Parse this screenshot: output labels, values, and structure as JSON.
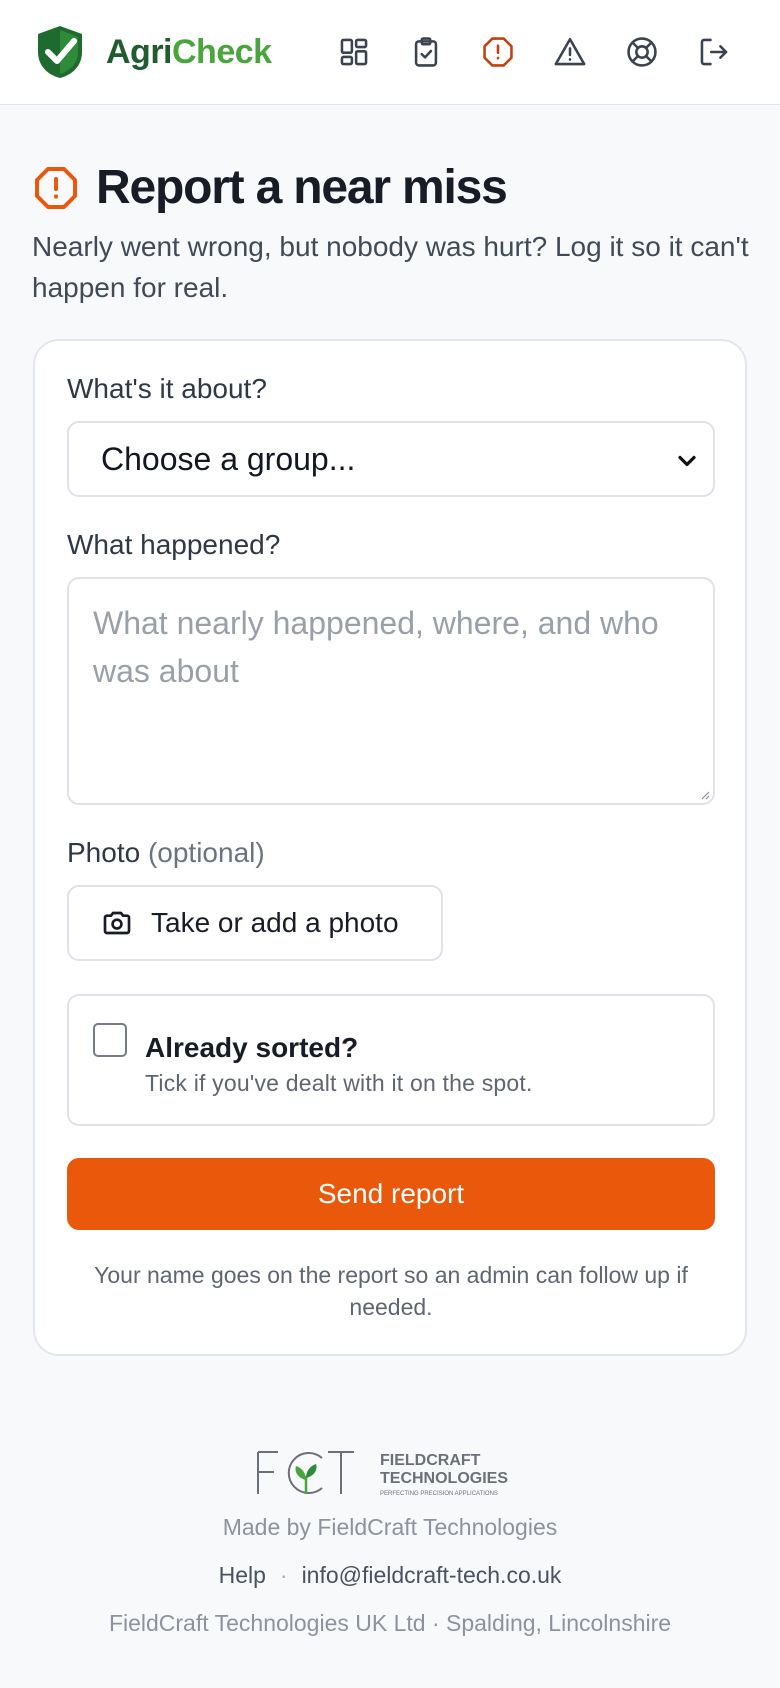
{
  "brand": {
    "name_part1": "Agri",
    "name_part2": "Check",
    "primary_color": "#1f5c2e",
    "accent_color": "#4aa53d"
  },
  "nav": [
    {
      "icon": "dashboard-icon"
    },
    {
      "icon": "clipboard-check-icon"
    },
    {
      "icon": "alert-octagon-icon",
      "active": true,
      "color": "#c2410c"
    },
    {
      "icon": "warning-triangle-icon"
    },
    {
      "icon": "lifebuoy-icon"
    },
    {
      "icon": "logout-icon"
    }
  ],
  "page": {
    "title": "Report a near miss",
    "subtitle": "Nearly went wrong, but nobody was hurt? Log it so it can't happen for real."
  },
  "form": {
    "group_label": "What's it about?",
    "group_select_value": "Choose a group...",
    "happened_label": "What happened?",
    "happened_placeholder": "What nearly happened, where, and who was about",
    "photo_label": "Photo",
    "photo_label_hint": "(optional)",
    "photo_button": "Take or add a photo",
    "sorted_title": "Already sorted?",
    "sorted_subtitle": "Tick if you've dealt with it on the spot.",
    "sorted_checked": false,
    "submit_button": "Send report",
    "submit_color": "#ea580c",
    "footnote": "Your name goes on the report so an admin can follow up if needed."
  },
  "footer": {
    "logo_letters": "FCT",
    "logo_line1": "FIELDCRAFT",
    "logo_line2": "TECHNOLOGIES",
    "logo_tagline": "PERFECTING PRECISION APPLICATIONS",
    "made_by": "Made by FieldCraft Technologies",
    "help_link": "Help",
    "separator": "·",
    "email_link": "info@fieldcraft-tech.co.uk",
    "company": "FieldCraft Technologies UK Ltd · Spalding, Lincolnshire"
  }
}
